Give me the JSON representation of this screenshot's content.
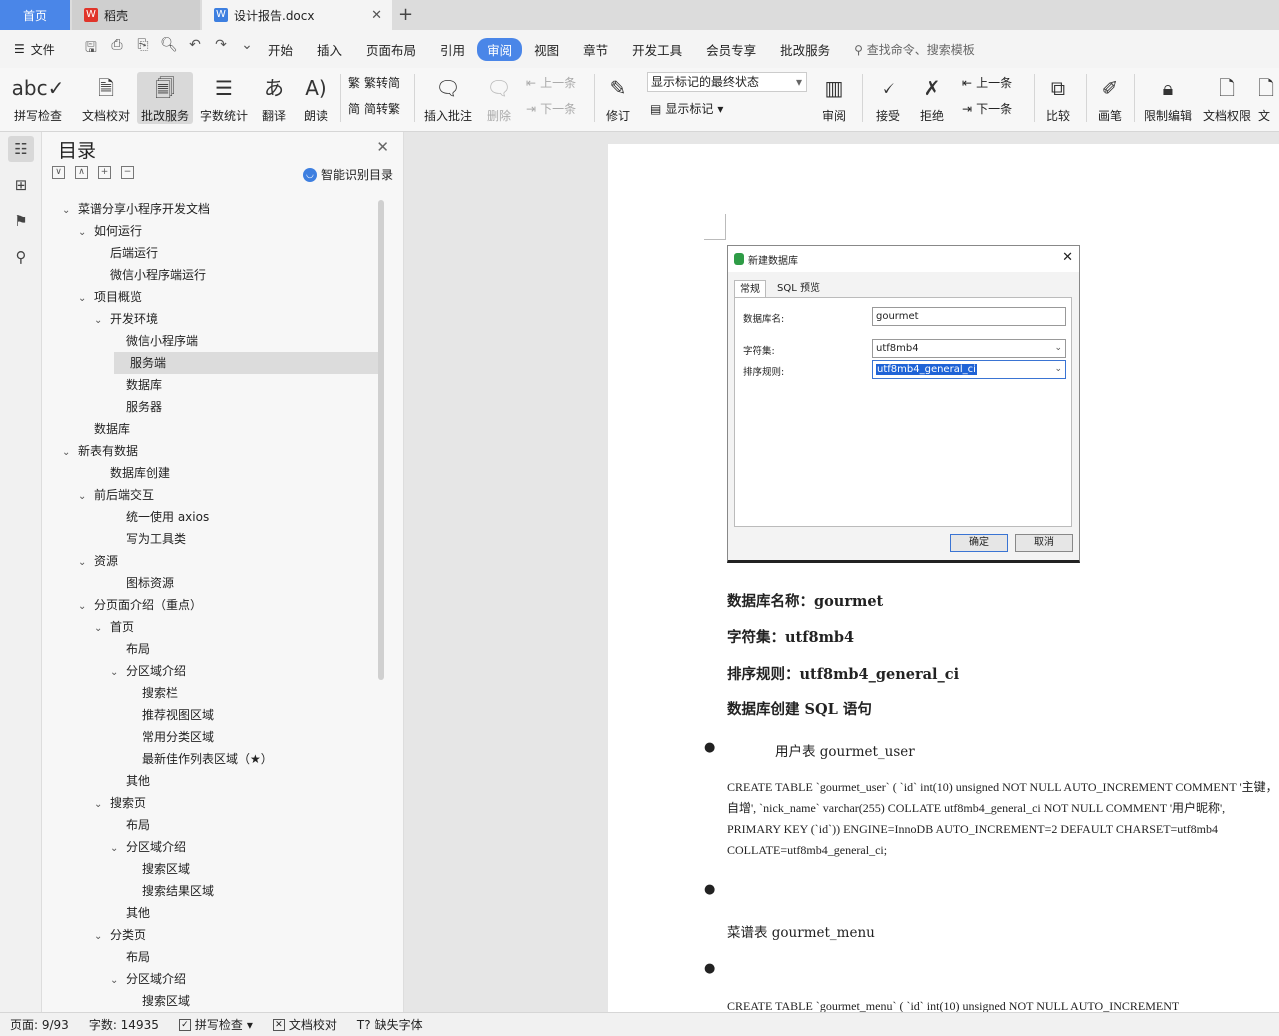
{
  "tabs": {
    "home": "首页",
    "wps": "稻壳",
    "doc": "设计报告.docx"
  },
  "menu": {
    "file": "文件",
    "items": [
      "开始",
      "插入",
      "页面布局",
      "引用",
      "审阅",
      "视图",
      "章节",
      "开发工具",
      "会员专享",
      "批改服务"
    ],
    "active": "审阅",
    "search": "查找命令、搜索模板"
  },
  "ribbon": {
    "spell": "拼写检查",
    "doccheck": "文档校对",
    "revise_service": "批改服务",
    "wordcount": "字数统计",
    "translate": "翻译",
    "read": "朗读",
    "t2s": "繁转简",
    "s2t": "简转繁",
    "insert_comment": "插入批注",
    "delete": "删除",
    "prev": "上一条",
    "next": "下一条",
    "revise": "修订",
    "markup_state": "显示标记的最终状态",
    "show_markup": "显示标记",
    "review": "审阅",
    "accept": "接受",
    "reject": "拒绝",
    "prev2": "上一条",
    "next2": "下一条",
    "compare": "比较",
    "pen": "画笔",
    "restrict": "限制编辑",
    "doc_perm": "文档权限",
    "doc_cut": "文"
  },
  "toc": {
    "title": "目录",
    "ai": "智能识别目录",
    "items": [
      {
        "text": "菜谱分享小程序开发文档",
        "level": 0,
        "caret": true
      },
      {
        "text": "如何运行",
        "level": 1,
        "caret": true
      },
      {
        "text": "后端运行",
        "level": 2,
        "caret": false
      },
      {
        "text": "微信小程序端运行",
        "level": 2,
        "caret": false
      },
      {
        "text": "项目概览",
        "level": 1,
        "caret": true
      },
      {
        "text": "开发环境",
        "level": 2,
        "caret": true
      },
      {
        "text": "微信小程序端",
        "level": 3,
        "caret": false
      },
      {
        "text": "服务端",
        "level": 3,
        "caret": false,
        "selected": true
      },
      {
        "text": "数据库",
        "level": 3,
        "caret": false
      },
      {
        "text": "服务器",
        "level": 3,
        "caret": false
      },
      {
        "text": "数据库",
        "level": 1,
        "caret": false
      },
      {
        "text": "新表有数据",
        "level": 0,
        "caret": true
      },
      {
        "text": "数据库创建",
        "level": 2,
        "caret": false
      },
      {
        "text": "前后端交互",
        "level": 1,
        "caret": true
      },
      {
        "text": "统一使用 axios",
        "level": 3,
        "caret": false
      },
      {
        "text": "写为工具类",
        "level": 3,
        "caret": false
      },
      {
        "text": "资源",
        "level": 1,
        "caret": true
      },
      {
        "text": "图标资源",
        "level": 3,
        "caret": false
      },
      {
        "text": "分页面介绍（重点）",
        "level": 1,
        "caret": true
      },
      {
        "text": "首页",
        "level": 2,
        "caret": true
      },
      {
        "text": "布局",
        "level": 3,
        "caret": false
      },
      {
        "text": "分区域介绍",
        "level": 3,
        "caret": true
      },
      {
        "text": "搜索栏",
        "level": 4,
        "caret": false
      },
      {
        "text": "推荐视图区域",
        "level": 4,
        "caret": false
      },
      {
        "text": "常用分类区域",
        "level": 4,
        "caret": false
      },
      {
        "text": "最新佳作列表区域（★）",
        "level": 4,
        "caret": false
      },
      {
        "text": "其他",
        "level": 3,
        "caret": false
      },
      {
        "text": "搜索页",
        "level": 2,
        "caret": true
      },
      {
        "text": "布局",
        "level": 3,
        "caret": false
      },
      {
        "text": "分区域介绍",
        "level": 3,
        "caret": true
      },
      {
        "text": "搜索区域",
        "level": 4,
        "caret": false
      },
      {
        "text": "搜索结果区域",
        "level": 4,
        "caret": false
      },
      {
        "text": "其他",
        "level": 3,
        "caret": false
      },
      {
        "text": "分类页",
        "level": 2,
        "caret": true
      },
      {
        "text": "布局",
        "level": 3,
        "caret": false
      },
      {
        "text": "分区域介绍",
        "level": 3,
        "caret": true
      },
      {
        "text": "搜索区域",
        "level": 4,
        "caret": false
      }
    ]
  },
  "dialog": {
    "title": "新建数据库",
    "tab_general": "常规",
    "tab_sql": "SQL 预览",
    "name_label": "数据库名:",
    "name_value": "gourmet",
    "charset_label": "字符集:",
    "charset_value": "utf8mb4",
    "collation_label": "排序规则:",
    "collation_value": "utf8mb4_general_ci",
    "ok": "确定",
    "cancel": "取消"
  },
  "doc": {
    "db_name": "数据库名称：gourmet",
    "charset": "字符集：utf8mb4",
    "collation": "排序规则：utf8mb4_general_ci",
    "sql_heading": "数据库创建 SQL 语句",
    "user_table": "用户表 gourmet_user",
    "user_sql": "CREATE TABLE `gourmet_user` (   `id` int(10) unsigned NOT NULL AUTO_INCREMENT COMMENT '主键，自增',   `nick_name` varchar(255) COLLATE utf8mb4_general_ci NOT NULL COMMENT '用户昵称',   PRIMARY KEY (`id`)) ENGINE=InnoDB AUTO_INCREMENT=2 DEFAULT CHARSET=utf8mb4 COLLATE=utf8mb4_general_ci;",
    "menu_table": "菜谱表 gourmet_menu",
    "menu_sql": "CREATE TABLE `gourmet_menu` (   `id` int(10) unsigned NOT NULL AUTO_INCREMENT"
  },
  "status": {
    "page": "页面: 9/93",
    "words": "字数: 14935",
    "spell": "拼写检查",
    "doccheck": "文档校对",
    "missing_font": "缺失字体"
  }
}
